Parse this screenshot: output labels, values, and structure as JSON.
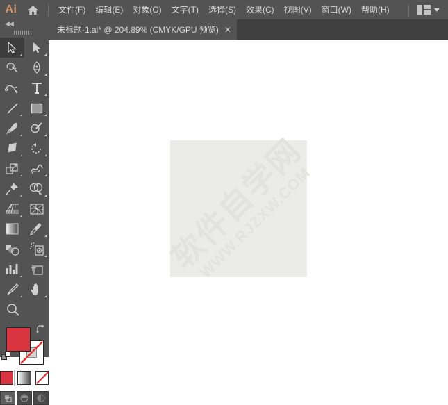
{
  "app": {
    "logo_text": "Ai",
    "home_icon": "home-icon",
    "workspace_icon": "workspace-switcher-icon",
    "chevron_icon": "chevron-down-icon"
  },
  "menubar": {
    "items": [
      {
        "label": "文件(F)",
        "name": "menu-file"
      },
      {
        "label": "编辑(E)",
        "name": "menu-edit"
      },
      {
        "label": "对象(O)",
        "name": "menu-object"
      },
      {
        "label": "文字(T)",
        "name": "menu-type"
      },
      {
        "label": "选择(S)",
        "name": "menu-select"
      },
      {
        "label": "效果(C)",
        "name": "menu-effect"
      },
      {
        "label": "视图(V)",
        "name": "menu-view"
      },
      {
        "label": "窗口(W)",
        "name": "menu-window"
      },
      {
        "label": "帮助(H)",
        "name": "menu-help"
      }
    ]
  },
  "tabbar": {
    "tab_title": "未标题-1.ai* @ 204.89% (CMYK/GPU 预览)",
    "close_label": "✕"
  },
  "toolbar": {
    "collapse_label": "◀◀",
    "tools": [
      {
        "label": "选择工具",
        "name": "tool-selection",
        "icon": "selection-arrow-icon",
        "active": true,
        "corner": true
      },
      {
        "label": "直接选择工具",
        "name": "tool-direct-selection",
        "icon": "direct-selection-arrow-icon",
        "active": false,
        "corner": true
      },
      {
        "label": "魔棒工具",
        "name": "tool-magic-wand",
        "icon": "magic-wand-icon",
        "active": false,
        "corner": false
      },
      {
        "label": "钢笔工具",
        "name": "tool-pen",
        "icon": "pen-icon",
        "active": false,
        "corner": true
      },
      {
        "label": "曲率工具",
        "name": "tool-curvature",
        "icon": "curvature-icon",
        "active": false,
        "corner": false
      },
      {
        "label": "文字工具",
        "name": "tool-type",
        "icon": "type-t-icon",
        "active": false,
        "corner": true
      },
      {
        "label": "直线段工具",
        "name": "tool-line-segment",
        "icon": "line-segment-icon",
        "active": false,
        "corner": true
      },
      {
        "label": "矩形工具",
        "name": "tool-rectangle",
        "icon": "rectangle-icon",
        "active": false,
        "corner": true
      },
      {
        "label": "画笔工具",
        "name": "tool-paintbrush",
        "icon": "paintbrush-icon",
        "active": false,
        "corner": true
      },
      {
        "label": "Shaper 工具",
        "name": "tool-shaper",
        "icon": "shaper-icon",
        "active": false,
        "corner": true
      },
      {
        "label": "橡皮擦工具",
        "name": "tool-eraser",
        "icon": "eraser-icon",
        "active": false,
        "corner": true
      },
      {
        "label": "旋转工具",
        "name": "tool-rotate",
        "icon": "rotate-icon",
        "active": false,
        "corner": true
      },
      {
        "label": "比例缩放工具",
        "name": "tool-scale",
        "icon": "scale-icon",
        "active": false,
        "corner": true
      },
      {
        "label": "宽度工具",
        "name": "tool-width",
        "icon": "width-warp-icon",
        "active": false,
        "corner": true
      },
      {
        "label": "自由变换工具",
        "name": "tool-free-transform",
        "icon": "free-transform-pin-icon",
        "active": false,
        "corner": true
      },
      {
        "label": "形状生成器工具",
        "name": "tool-shape-builder",
        "icon": "shape-builder-icon",
        "active": false,
        "corner": true
      },
      {
        "label": "透视网格工具",
        "name": "tool-perspective-grid",
        "icon": "perspective-grid-icon",
        "active": false,
        "corner": true
      },
      {
        "label": "网格工具",
        "name": "tool-mesh",
        "icon": "mesh-icon",
        "active": false,
        "corner": false
      },
      {
        "label": "渐变工具",
        "name": "tool-gradient",
        "icon": "gradient-icon",
        "active": false,
        "corner": false
      },
      {
        "label": "吸管工具",
        "name": "tool-eyedropper",
        "icon": "eyedropper-icon",
        "active": false,
        "corner": true
      },
      {
        "label": "混合工具",
        "name": "tool-blend",
        "icon": "blend-icon",
        "active": false,
        "corner": false
      },
      {
        "label": "符号喷枪工具",
        "name": "tool-symbol-sprayer",
        "icon": "symbol-sprayer-icon",
        "active": false,
        "corner": true
      },
      {
        "label": "柱形图工具",
        "name": "tool-column-graph",
        "icon": "column-graph-icon",
        "active": false,
        "corner": true
      },
      {
        "label": "画板工具",
        "name": "tool-artboard",
        "icon": "artboard-icon",
        "active": false,
        "corner": false
      },
      {
        "label": "切片工具",
        "name": "tool-slice",
        "icon": "slice-knife-icon",
        "active": false,
        "corner": true
      },
      {
        "label": "抓手工具",
        "name": "tool-hand",
        "icon": "hand-icon",
        "active": false,
        "corner": true
      },
      {
        "label": "缩放工具",
        "name": "tool-zoom",
        "icon": "magnifier-icon",
        "active": false,
        "corner": false
      }
    ],
    "fill_stroke": {
      "fill_color": "#d9333f",
      "stroke_color": "#ffffff",
      "swap_icon": "swap-fill-stroke-icon",
      "default_icon": "default-fill-stroke-icon"
    },
    "color_modes": [
      {
        "name": "color-mode-color",
        "label": "颜色",
        "selected": true
      },
      {
        "name": "color-mode-gradient",
        "label": "渐变",
        "selected": false
      },
      {
        "name": "color-mode-none",
        "label": "无",
        "selected": false
      }
    ],
    "screen_modes": [
      {
        "name": "screen-mode-normal",
        "label": "正常屏幕模式",
        "active": true
      },
      {
        "name": "screen-mode-full-menu",
        "label": "带有菜单栏的全屏模式",
        "active": false
      },
      {
        "name": "screen-mode-full",
        "label": "全屏模式",
        "active": false
      }
    ]
  },
  "canvas": {
    "artboard_fill": "#ebebe9",
    "background": "#ffffff",
    "watermark_cn": "软件自学网",
    "watermark_en": "WWW.RJZXW.COM"
  }
}
